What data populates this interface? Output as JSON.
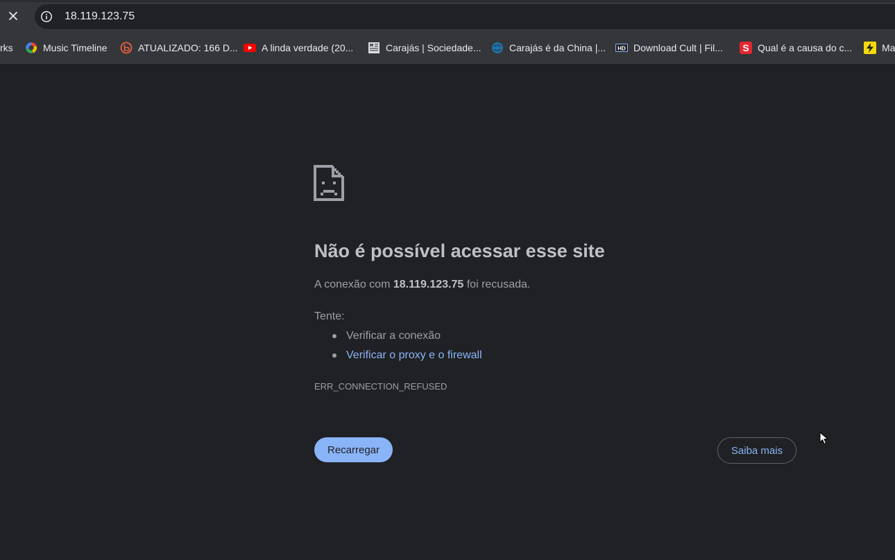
{
  "browser": {
    "url": "18.119.123.75",
    "close_icon": "close-icon",
    "site_info_icon": "info-icon"
  },
  "bookmarks": [
    {
      "label": "rks",
      "icon": ""
    },
    {
      "label": "Music Timeline",
      "icon": "google-color-icon"
    },
    {
      "label": "ATUALIZADO: 166 D...",
      "icon": "blogger-icon"
    },
    {
      "label": "A linda verdade (20...",
      "icon": "youtube-icon"
    },
    {
      "label": "Carajás | Sociedade...",
      "icon": "newspaper-icon"
    },
    {
      "label": "Carajás é da China |...",
      "icon": "globe-icon"
    },
    {
      "label": "Download Cult | Fil...",
      "icon": "hd-icon"
    },
    {
      "label": "Qual é a causa do c...",
      "icon": "s-icon"
    },
    {
      "label": "Ma",
      "icon": "bolt-icon"
    }
  ],
  "error": {
    "icon": "sad-document-icon",
    "heading": "Não é possível acessar esse site",
    "desc_prefix": "A conexão com ",
    "desc_host": "18.119.123.75",
    "desc_suffix": " foi recusada.",
    "try_label": "Tente:",
    "suggestions": [
      {
        "text": "Verificar a conexão",
        "link": false
      },
      {
        "text": "Verificar o proxy e o firewall",
        "link": true
      }
    ],
    "code": "ERR_CONNECTION_REFUSED",
    "reload_label": "Recarregar",
    "more_label": "Saiba mais"
  },
  "colors": {
    "background": "#202124",
    "toolbar": "#35363a",
    "link": "#8ab4f8",
    "text_muted": "#9aa0a6",
    "heading": "#bdc1c6"
  }
}
